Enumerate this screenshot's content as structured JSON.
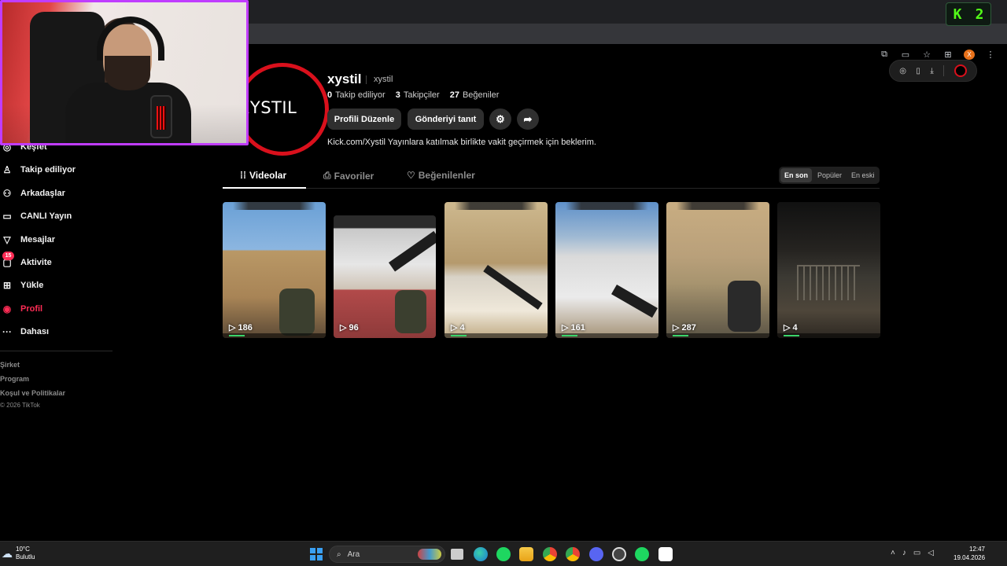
{
  "profile": {
    "avatar_text": "XYSTIL",
    "username": "xystil",
    "nickname": "xystil",
    "following_count": "0",
    "following_label": "Takip ediliyor",
    "followers_count": "3",
    "followers_label": "Takipçiler",
    "likes_count": "27",
    "likes_label": "Beğeniler",
    "edit_button": "Profili Düzenle",
    "promote_button": "Gönderiyi tanıt",
    "bio": "Kick.com/Xystil Yayınlara katılmak birlikte vakit geçirmek için beklerim."
  },
  "sidebar": {
    "items": [
      {
        "label": "Keşfet",
        "icon": "compass-icon"
      },
      {
        "label": "Takip ediliyor",
        "icon": "person-follow-icon"
      },
      {
        "label": "Arkadaşlar",
        "icon": "friends-icon"
      },
      {
        "label": "CANLI Yayın",
        "icon": "live-tv-icon"
      },
      {
        "label": "Mesajlar",
        "icon": "send-icon"
      },
      {
        "label": "Aktivite",
        "icon": "activity-icon",
        "badge": "15"
      },
      {
        "label": "Yükle",
        "icon": "upload-plus-icon"
      },
      {
        "label": "Profil",
        "icon": "profile-avatar-icon"
      },
      {
        "label": "Dahası",
        "icon": "more-dots-icon"
      }
    ],
    "footer": {
      "company": "Şirket",
      "program": "Program",
      "terms": "Koşul ve Politikalar",
      "copyright": "© 2026 TikTok"
    }
  },
  "tabs": [
    {
      "label": "Videolar",
      "icon": "grid-icon",
      "active": true
    },
    {
      "label": "Favoriler",
      "icon": "bookmark-icon",
      "active": false
    },
    {
      "label": "Beğenilenler",
      "icon": "heart-icon",
      "active": false
    }
  ],
  "sort": {
    "options": [
      "En son",
      "Popüler",
      "En eski"
    ],
    "selected": "En son"
  },
  "videos": [
    {
      "views": "186"
    },
    {
      "views": "96"
    },
    {
      "views": "4"
    },
    {
      "views": "161"
    },
    {
      "views": "287"
    },
    {
      "views": "4"
    }
  ],
  "browser": {
    "kick_letter": "K",
    "kick_count": "2",
    "extension_avatar": "X"
  },
  "taskbar": {
    "temperature": "10°C",
    "weather": "Bulutlu",
    "search_placeholder": "Ara",
    "time": "12:47",
    "date": "19.04.2026"
  },
  "colors": {
    "accent": "#fe2c55",
    "avatar_ring": "#d9101c",
    "kick_green": "#53fc18",
    "webcam_border": "#c03cff"
  }
}
